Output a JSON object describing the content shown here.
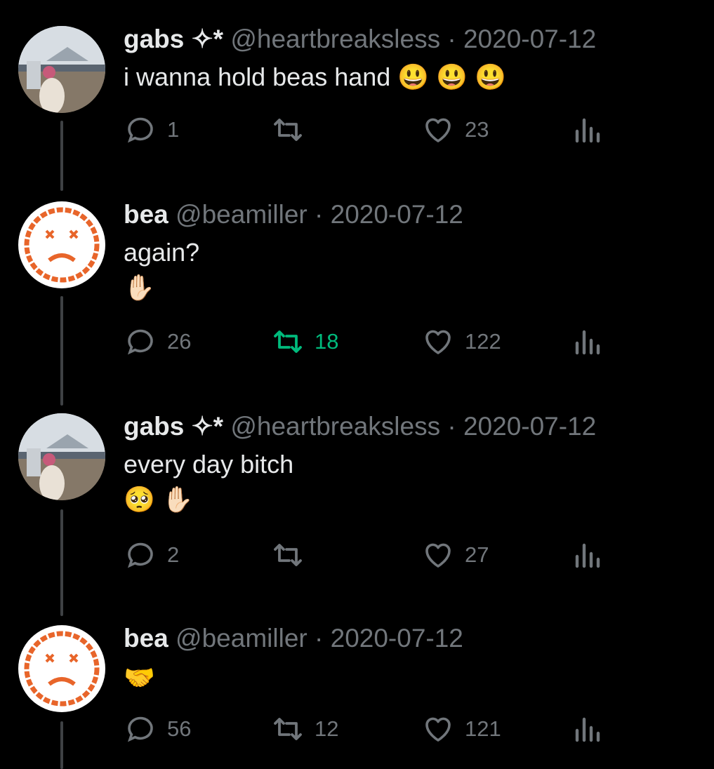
{
  "tweets": [
    {
      "name": "gabs ✧*",
      "handle": "@heartbreaksless",
      "date": "· 2020-07-12",
      "text": "i wanna hold beas hand",
      "emoji": "😃 😃 😃",
      "replies": "1",
      "retweets": "",
      "likes": "23",
      "retweeted": false,
      "avatar": "photo"
    },
    {
      "name": "bea",
      "handle": "@beamiller",
      "date": "· 2020-07-12",
      "text": "again?",
      "emoji": "✋🏻",
      "replies": "26",
      "retweets": "18",
      "likes": "122",
      "retweeted": true,
      "avatar": "pixel-face"
    },
    {
      "name": "gabs ✧*",
      "handle": "@heartbreaksless",
      "date": "· 2020-07-12",
      "text": "every day bitch",
      "emoji": "🥺 ✋🏻",
      "replies": "2",
      "retweets": "",
      "likes": "27",
      "retweeted": false,
      "avatar": "photo"
    },
    {
      "name": "bea",
      "handle": "@beamiller",
      "date": "· 2020-07-12",
      "text": "",
      "emoji": "🤝",
      "replies": "56",
      "retweets": "12",
      "likes": "121",
      "retweeted": false,
      "avatar": "pixel-face"
    }
  ],
  "colors": {
    "background": "#000000",
    "text": "#e7e9ea",
    "muted": "#71767b",
    "retweet_active": "#00ba7c",
    "avatar_accent": "#e8652a"
  },
  "icons": {
    "reply": "speech-bubble-icon",
    "retweet": "retweet-icon",
    "like": "heart-icon",
    "views": "bar-chart-icon"
  }
}
